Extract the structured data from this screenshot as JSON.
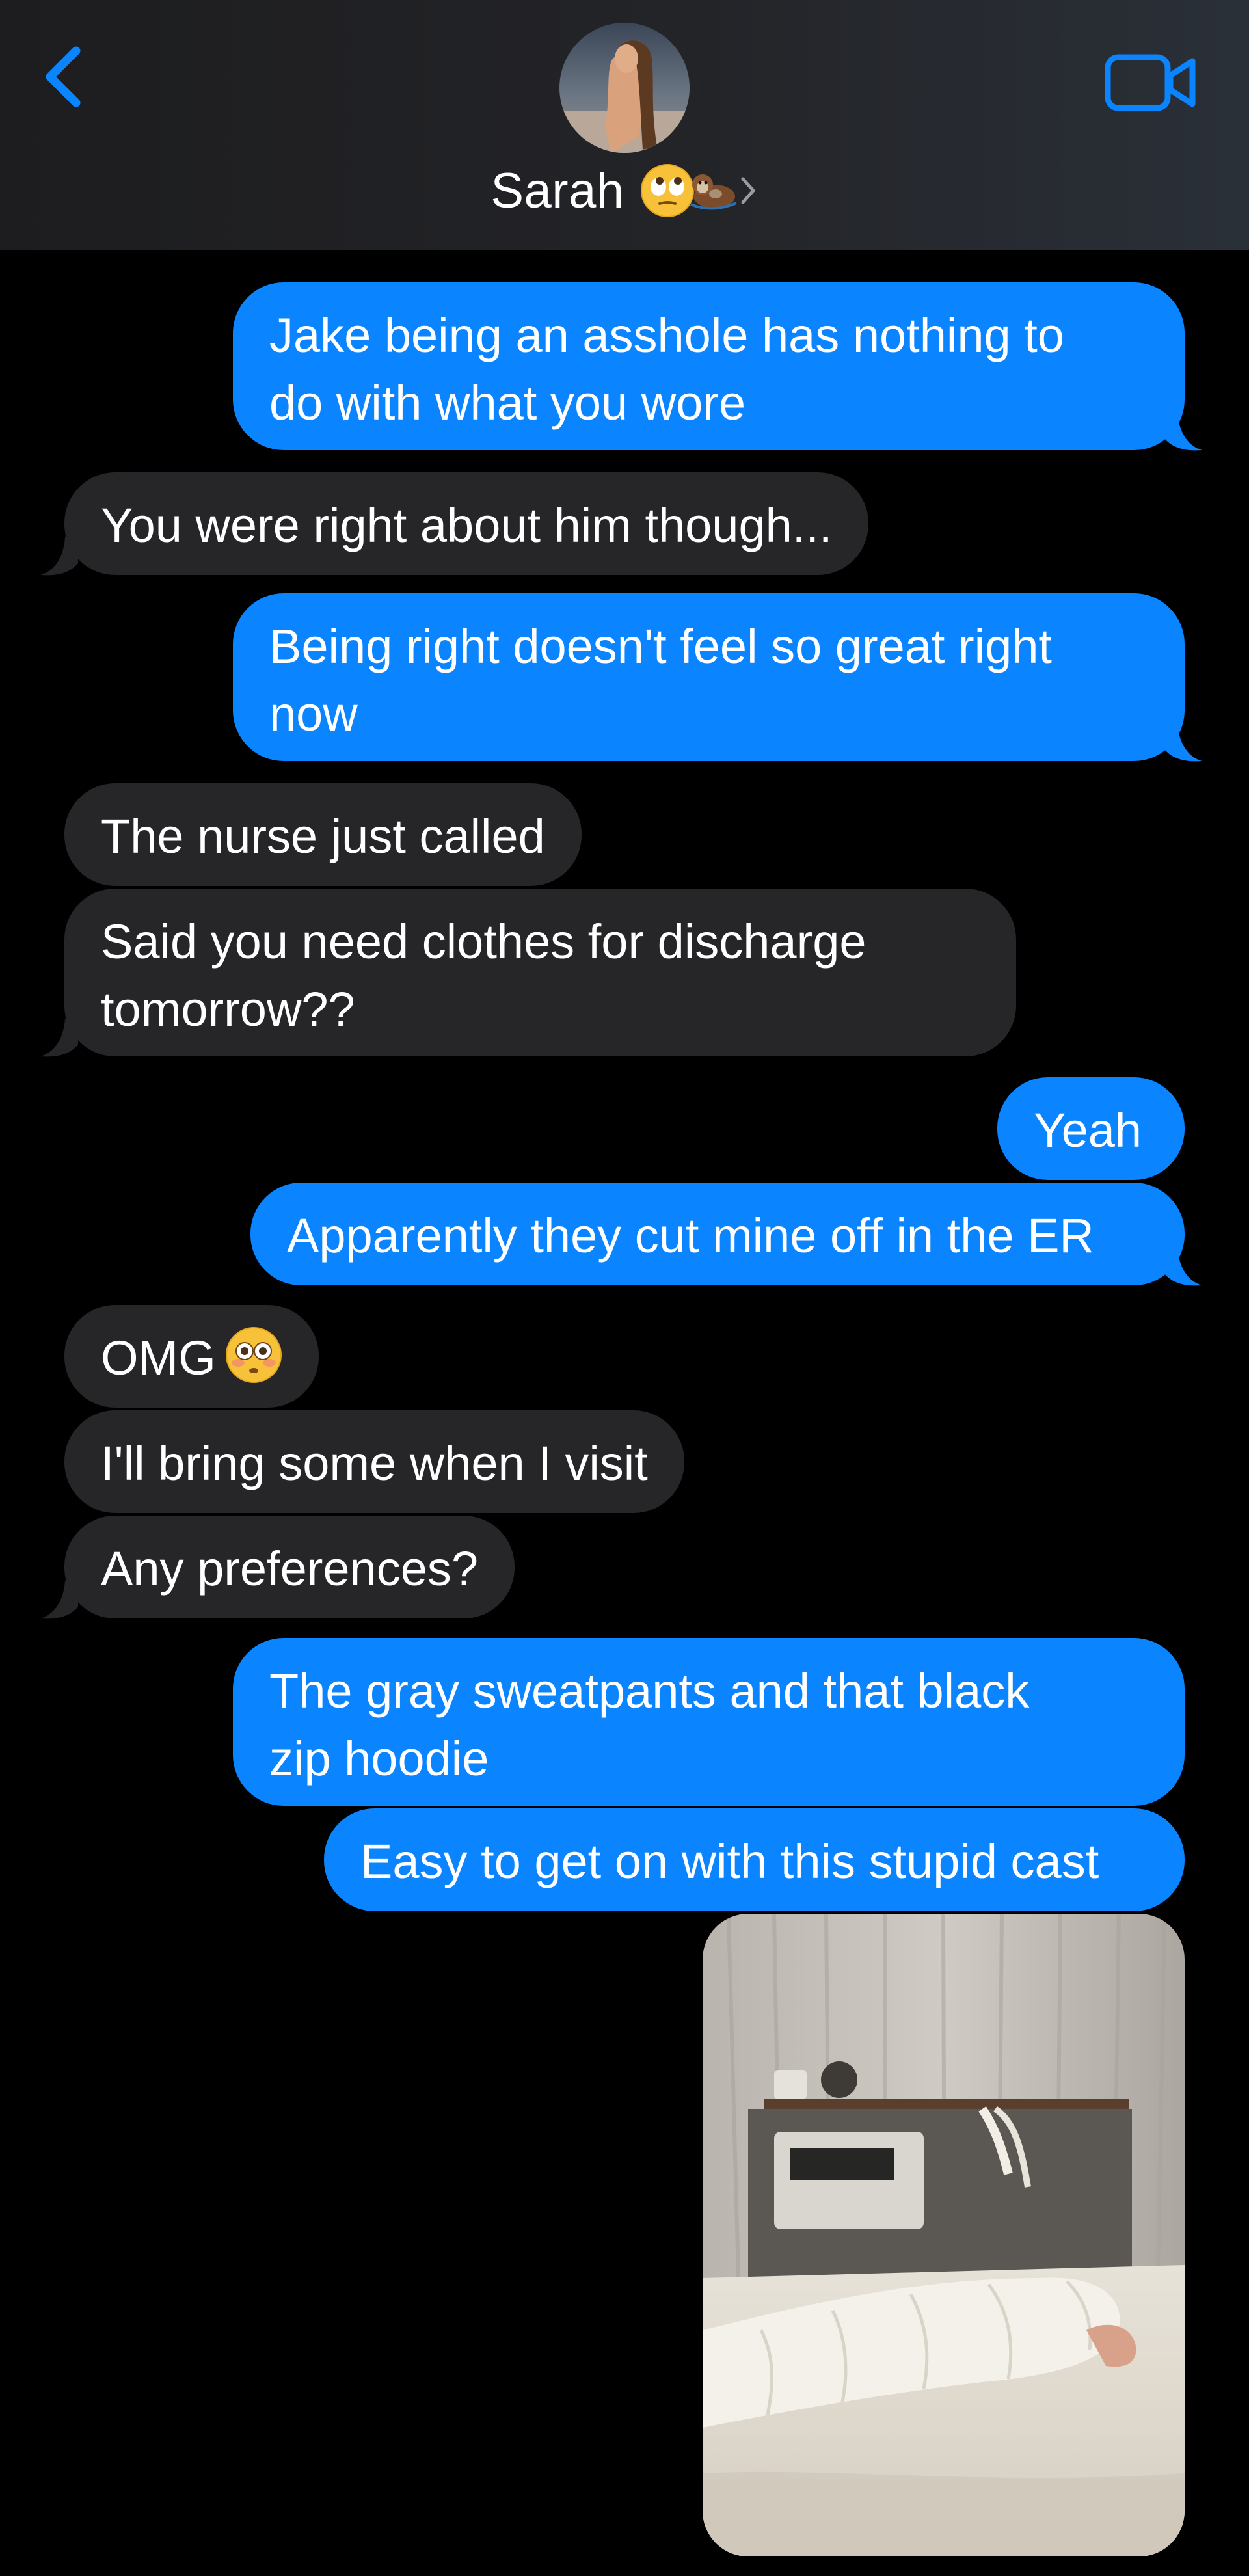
{
  "header": {
    "contact_name": "Sarah",
    "name_emojis": [
      "face-with-rolling-eyes",
      "otter"
    ]
  },
  "messages": [
    {
      "side": "sent",
      "text_lines": [
        "Jake being an asshole has nothing to",
        "do with what you wore"
      ]
    },
    {
      "side": "received",
      "text": "You were right about him though..."
    },
    {
      "side": "sent",
      "text_lines": [
        "Being right doesn't feel so great right",
        "now"
      ]
    },
    {
      "side": "received",
      "text": "The nurse just called"
    },
    {
      "side": "received",
      "text_lines": [
        "Said you need clothes for discharge",
        "tomorrow??"
      ]
    },
    {
      "side": "sent",
      "text": "Yeah"
    },
    {
      "side": "sent",
      "text": "Apparently they cut mine off in the ER"
    },
    {
      "side": "received",
      "text": "OMG",
      "emoji": "flushed-face"
    },
    {
      "side": "received",
      "text": "I'll bring some when I visit"
    },
    {
      "side": "received",
      "text": "Any preferences?"
    },
    {
      "side": "sent",
      "text_lines": [
        "The gray sweatpants and that black",
        "zip hoodie"
      ]
    },
    {
      "side": "sent",
      "text": "Easy to get on with this stupid cast"
    },
    {
      "side": "sent",
      "attachment": "photo-arm-in-cast-hospital-bed"
    }
  ],
  "icons": {
    "back": "chevron-left-icon",
    "video": "video-camera-icon",
    "chevron": "chevron-right-icon"
  },
  "colors": {
    "sent_bubble": "#0a84ff",
    "received_bubble": "#262628",
    "accent": "#0a84ff",
    "background": "#000000"
  }
}
